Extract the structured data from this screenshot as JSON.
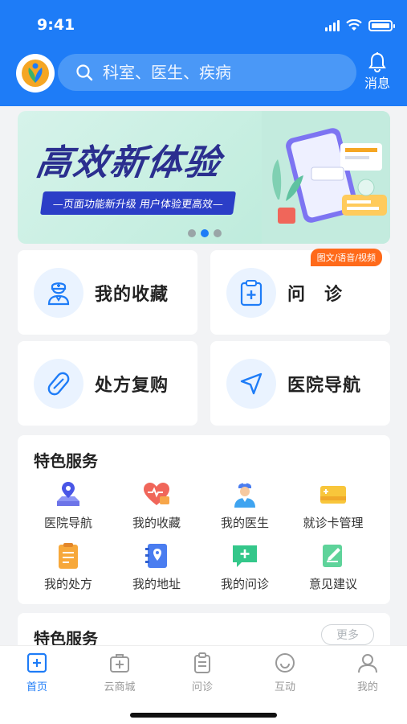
{
  "status": {
    "time": "9:41"
  },
  "header": {
    "search_placeholder": "科室、医生、疾病",
    "message_label": "消息"
  },
  "banner": {
    "title": "高效新体验",
    "subtitle": "—页面功能新升级 用户体验更高效—",
    "page_count": 3,
    "active_page": 2
  },
  "quick_cards": [
    {
      "label": "我的收藏",
      "icon": "doctor-icon"
    },
    {
      "label": "问　诊",
      "icon": "clipboard-plus-icon",
      "tag": "图文/语音/视频"
    },
    {
      "label": "处方复购",
      "icon": "pill-icon"
    },
    {
      "label": "医院导航",
      "icon": "navigation-arrow-icon"
    }
  ],
  "services": {
    "title": "特色服务",
    "items": [
      {
        "label": "医院导航",
        "icon": "map-pin-icon"
      },
      {
        "label": "我的收藏",
        "icon": "heart-icon"
      },
      {
        "label": "我的医生",
        "icon": "doctor-icon"
      },
      {
        "label": "就诊卡管理",
        "icon": "card-icon"
      },
      {
        "label": "我的处方",
        "icon": "prescription-icon"
      },
      {
        "label": "我的地址",
        "icon": "address-book-icon"
      },
      {
        "label": "我的问诊",
        "icon": "chat-plus-icon"
      },
      {
        "label": "意见建议",
        "icon": "edit-icon"
      }
    ]
  },
  "services2": {
    "title": "特色服务",
    "more_label": "更多"
  },
  "tabbar": [
    {
      "label": "首页",
      "icon": "home-plus-icon",
      "active": true
    },
    {
      "label": "云商城",
      "icon": "medical-bag-icon"
    },
    {
      "label": "问诊",
      "icon": "clipboard-icon"
    },
    {
      "label": "互动",
      "icon": "smile-icon"
    },
    {
      "label": "我的",
      "icon": "user-icon"
    }
  ],
  "colors": {
    "primary": "#1e7cf7",
    "tag": "#ff6a1a",
    "background": "#f2f3f5"
  }
}
